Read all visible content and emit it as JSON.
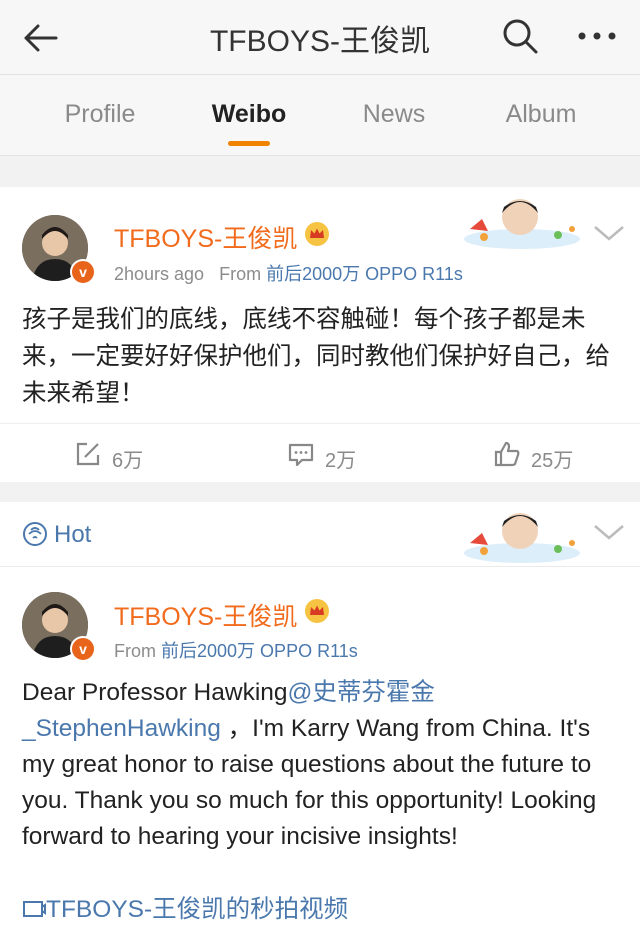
{
  "header": {
    "title": "TFBOYS-王俊凯"
  },
  "tabs": [
    {
      "label": "Profile"
    },
    {
      "label": "Weibo"
    },
    {
      "label": "News"
    },
    {
      "label": "Album"
    }
  ],
  "colors": {
    "accent": "#f08300",
    "name": "#f26b1d",
    "link": "#4a78ad"
  },
  "post1": {
    "author": "TFBOYS-王俊凯",
    "time": "2hours ago",
    "from_label": "From",
    "source": "前后2000万 OPPO R11s",
    "text": "孩子是我们的底线，底线不容触碰！每个孩子都是未来，一定要好好保护他们，同时教他们保护好自己，给未来希望！",
    "reposts": "6万",
    "comments": "2万",
    "likes": "25万"
  },
  "hot_section": {
    "label": "Hot"
  },
  "post2": {
    "author": "TFBOYS-王俊凯",
    "from_label": "From",
    "source": "前后2000万 OPPO R11s",
    "text_start": "Dear Professor Hawking",
    "mention": "@史蒂芬霍金_StephenHawking",
    "text_rest": " ，I'm Karry Wang from China. It's my great honor to raise questions about the future to you. Thank you so much for this opportunity! Looking forward to hearing your incisive insights!",
    "video_link": "TFBOYS-王俊凯的秒拍视频"
  }
}
